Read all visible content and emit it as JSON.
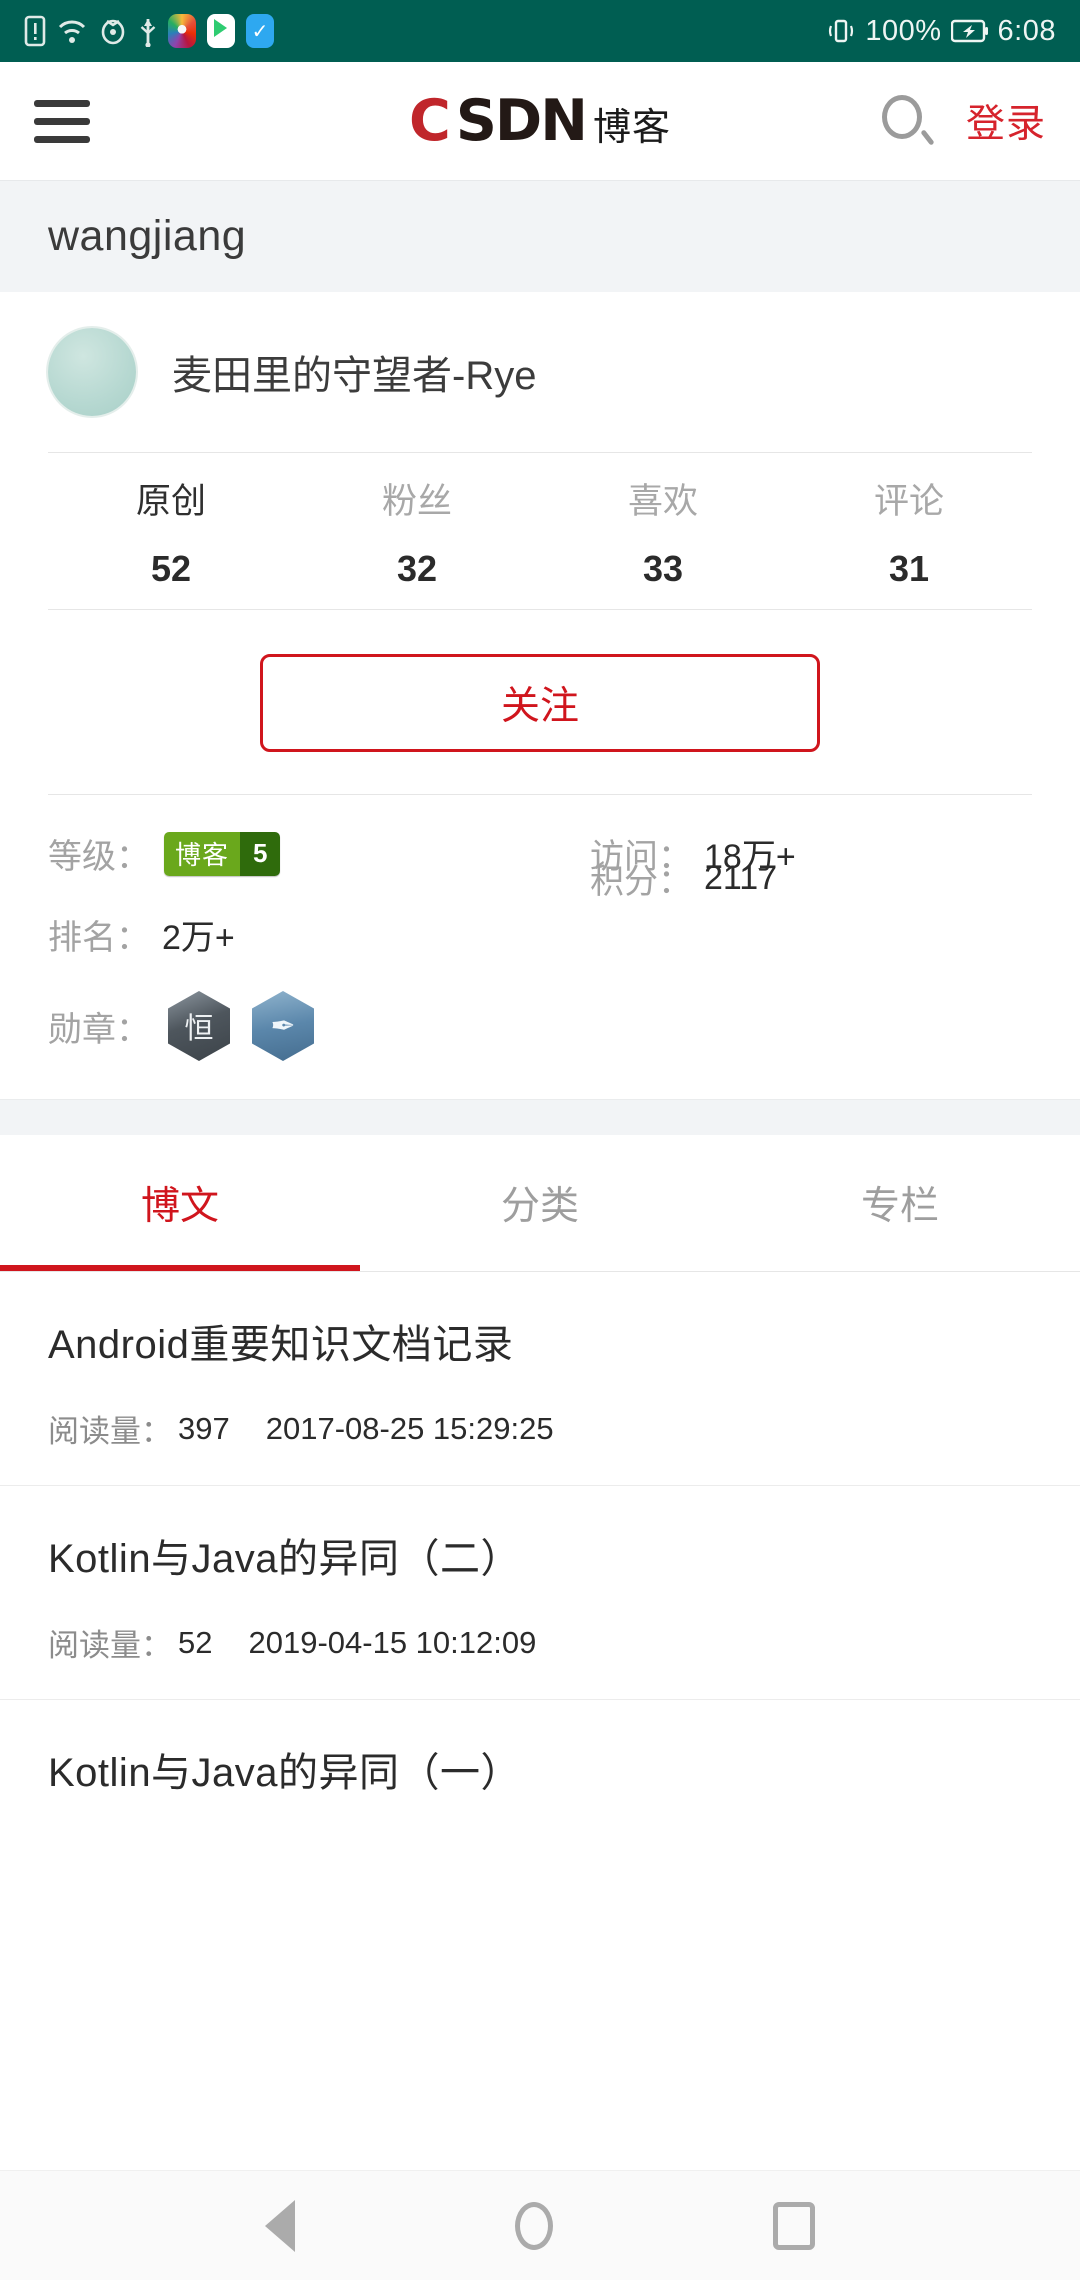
{
  "status_bar": {
    "icons": [
      "sim-alert-icon",
      "wifi-icon",
      "eye-care-icon",
      "usb-icon",
      "photos-app-icon",
      "play-store-app-icon",
      "blue-check-app-icon"
    ],
    "vibrate_icon": "vibrate-icon",
    "battery_percent": "100%",
    "battery_icon": "battery-charging-icon",
    "time": "6:08",
    "background_color": "#005e52"
  },
  "header": {
    "menu_icon": "hamburger-menu-icon",
    "logo_c": "C",
    "logo_sdn": "SDN",
    "logo_suffix": "博客",
    "search_icon": "search-icon",
    "login_label": "登录",
    "login_color": "#d6232c"
  },
  "user_banner": {
    "username": "wangjiang"
  },
  "profile": {
    "avatar": "user-avatar",
    "nickname": "麦田里的守望者-Rye",
    "stats": [
      {
        "label": "原创",
        "value": "52"
      },
      {
        "label": "粉丝",
        "value": "32"
      },
      {
        "label": "喜欢",
        "value": "33"
      },
      {
        "label": "评论",
        "value": "31"
      }
    ],
    "follow_button": "关注",
    "follow_color": "#d0151d",
    "meta": {
      "level_label": "等级：",
      "level_badge_text": "博客",
      "level_badge_number": "5",
      "level_badge_color": "#6aa81c",
      "visits_label": "访问：",
      "visits_value": "18万+",
      "points_label": "积分：",
      "points_value": "2117",
      "rank_label": "排名：",
      "rank_value": "2万+",
      "medal_label": "勋章：",
      "medals": [
        {
          "name": "persistence-medal-icon",
          "glyph": "恒",
          "color": "#4e565d"
        },
        {
          "name": "writer-medal-icon",
          "glyph": "✒",
          "color": "#5b87ab"
        }
      ]
    }
  },
  "tabs": [
    {
      "label": "博文",
      "active": true
    },
    {
      "label": "分类",
      "active": false
    },
    {
      "label": "专栏",
      "active": false
    }
  ],
  "articles": [
    {
      "title": "Android重要知识文档记录",
      "reads_label": "阅读量：",
      "reads": "397",
      "date": "2017-08-25 15:29:25"
    },
    {
      "title": "Kotlin与Java的异同（二）",
      "reads_label": "阅读量：",
      "reads": "52",
      "date": "2019-04-15 10:12:09"
    },
    {
      "title": "Kotlin与Java的异同（一）",
      "reads_label": "",
      "reads": "",
      "date": ""
    }
  ],
  "nav_bar": {
    "back_icon": "back-triangle-icon",
    "home_icon": "home-circle-icon",
    "recents_icon": "recents-square-icon"
  }
}
